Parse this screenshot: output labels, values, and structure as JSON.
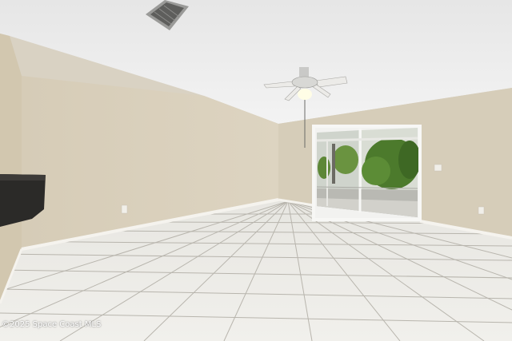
{
  "photo": {
    "watermark": "©2025 Space Coast MLS",
    "colors": {
      "ceiling": "#efefef",
      "left_wall": "#ddd3bf",
      "back_wall": "#d8cfbb",
      "right_wall": "#d4cbb6",
      "floor_tile": "#ecebe6",
      "grout": "#b9b6ae",
      "baseboard": "#f4f2ec",
      "foliage": "#4f7f2e"
    }
  }
}
